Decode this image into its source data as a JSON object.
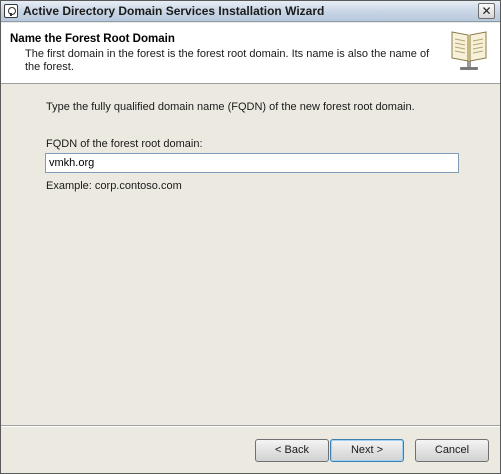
{
  "window": {
    "title": "Active Directory Domain Services Installation Wizard",
    "close_glyph": "✕"
  },
  "header": {
    "title": "Name the Forest Root Domain",
    "description": "The first domain in the forest is the forest root domain. Its name is also the name of the forest."
  },
  "content": {
    "instruction": "Type the fully qualified domain name (FQDN) of the new forest root domain.",
    "fqdn_label": "FQDN of the forest root domain:",
    "fqdn_value": "vmkh.org",
    "example": "Example: corp.contoso.com"
  },
  "buttons": {
    "back": "< Back",
    "next": "Next >",
    "cancel": "Cancel"
  },
  "colors": {
    "dialog_background": "#ece9e0",
    "header_background": "#ffffff",
    "title_bar": "#c9d6e6"
  }
}
